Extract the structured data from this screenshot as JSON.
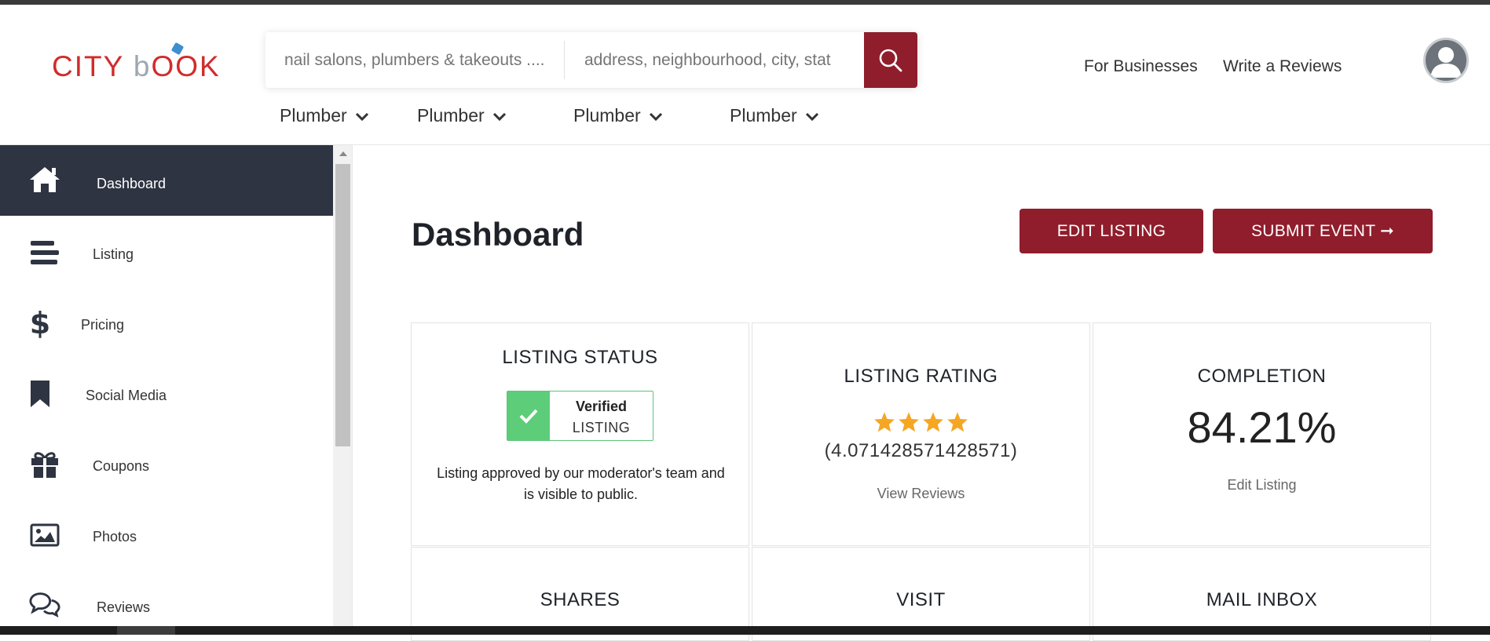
{
  "header": {
    "logo_text_left": "CITY ",
    "logo_text_b": "b",
    "logo_text_right": "OOK",
    "search_what_placeholder": "nail salons, plumbers & takeouts ....",
    "search_where_placeholder": "address, neighbourhood, city, stat",
    "categories": [
      "Plumber",
      "Plumber",
      "Plumber",
      "Plumber"
    ],
    "for_businesses": "For Businesses",
    "write_reviews": "Write a Reviews"
  },
  "sidebar": {
    "items": [
      {
        "label": "Dashboard",
        "icon": "home-icon",
        "active": true
      },
      {
        "label": "Listing",
        "icon": "bars-icon",
        "active": false
      },
      {
        "label": "Pricing",
        "icon": "dollar-icon",
        "active": false
      },
      {
        "label": "Social Media",
        "icon": "bookmark-icon",
        "active": false
      },
      {
        "label": "Coupons",
        "icon": "gift-icon",
        "active": false
      },
      {
        "label": "Photos",
        "icon": "image-icon",
        "active": false
      },
      {
        "label": "Reviews",
        "icon": "comments-icon",
        "active": false
      }
    ]
  },
  "main": {
    "title": "Dashboard",
    "edit_listing_label": "EDIT LISTING",
    "submit_event_label": "SUBMIT EVENT ➞",
    "cards": {
      "listing_status": {
        "title": "LISTING STATUS",
        "badge_top": "Verified",
        "badge_bottom": "LISTING",
        "description": "Listing approved by our moderator's team and is visible to public."
      },
      "listing_rating": {
        "title": "LISTING RATING",
        "stars": 4,
        "value": "(4.071428571428571)",
        "link": "View Reviews"
      },
      "completion": {
        "title": "COMPLETION",
        "value": "84.21%",
        "link": "Edit Listing"
      },
      "shares": {
        "title": "SHARES"
      },
      "visit": {
        "title": "VISIT"
      },
      "mail_inbox": {
        "title": "MAIL INBOX"
      }
    }
  },
  "colors": {
    "brand_red": "#8f1d2c",
    "logo_red": "#d22b2b",
    "sidebar_active": "#2e3441",
    "verified_green": "#5dcd7a",
    "star_orange": "#f5a623"
  }
}
